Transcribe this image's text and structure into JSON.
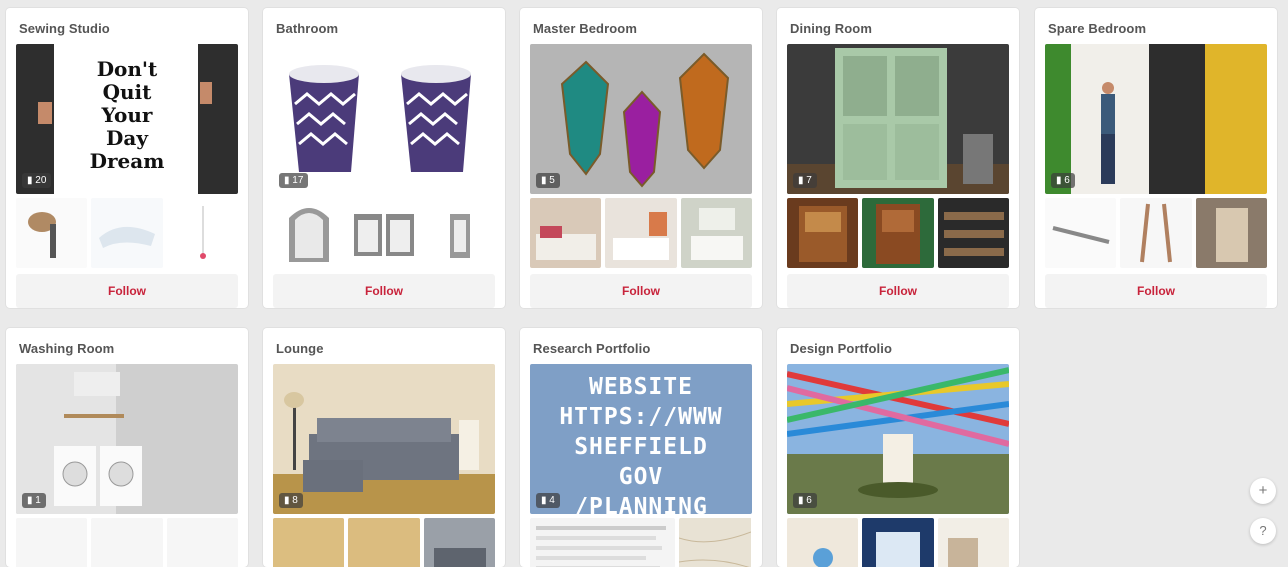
{
  "boards": [
    {
      "title": "Sewing Studio",
      "pins": "20",
      "follow": "Follow",
      "quote": [
        "Don't",
        "Quit",
        "Your",
        "Day",
        "Dream"
      ]
    },
    {
      "title": "Bathroom",
      "pins": "17",
      "follow": "Follow"
    },
    {
      "title": "Master Bedroom",
      "pins": "5",
      "follow": "Follow"
    },
    {
      "title": "Dining Room",
      "pins": "7",
      "follow": "Follow"
    },
    {
      "title": "Spare Bedroom",
      "pins": "6",
      "follow": "Follow"
    },
    {
      "title": "Washing Room",
      "pins": "1"
    },
    {
      "title": "Lounge",
      "pins": "8"
    },
    {
      "title": "Research Portfolio",
      "pins": "4",
      "sign": [
        "WEBSITE",
        "HTTPS://WWW",
        "SHEFFIELD",
        "GOV",
        "/PLANNING"
      ]
    },
    {
      "title": "Design Portfolio",
      "pins": "6"
    }
  ],
  "controls": {
    "add": "+",
    "help": "?"
  },
  "colors": {
    "follow": "#c8233b",
    "background": "#eaeaea"
  }
}
